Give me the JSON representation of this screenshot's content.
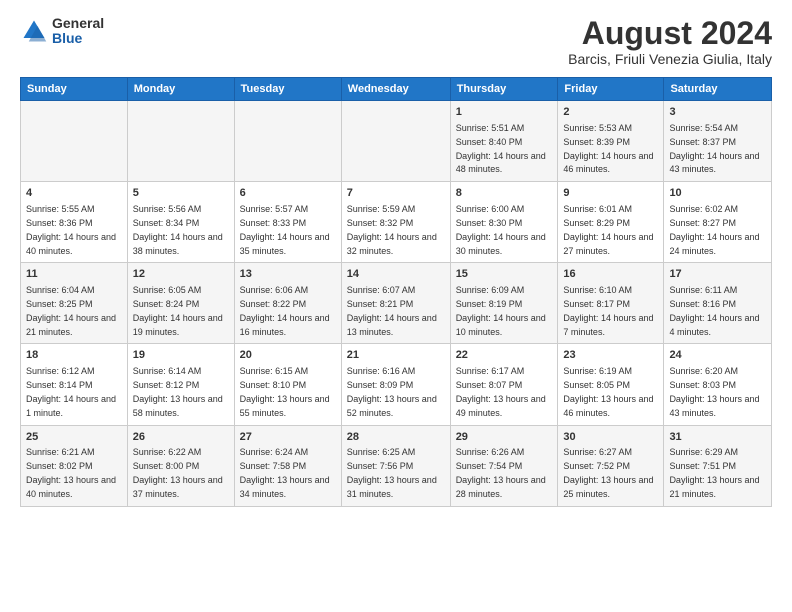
{
  "header": {
    "logo_general": "General",
    "logo_blue": "Blue",
    "title": "August 2024",
    "subtitle": "Barcis, Friuli Venezia Giulia, Italy"
  },
  "calendar": {
    "days_of_week": [
      "Sunday",
      "Monday",
      "Tuesday",
      "Wednesday",
      "Thursday",
      "Friday",
      "Saturday"
    ],
    "weeks": [
      [
        {
          "day": "",
          "info": ""
        },
        {
          "day": "",
          "info": ""
        },
        {
          "day": "",
          "info": ""
        },
        {
          "day": "",
          "info": ""
        },
        {
          "day": "1",
          "info": "Sunrise: 5:51 AM\nSunset: 8:40 PM\nDaylight: 14 hours and 48 minutes."
        },
        {
          "day": "2",
          "info": "Sunrise: 5:53 AM\nSunset: 8:39 PM\nDaylight: 14 hours and 46 minutes."
        },
        {
          "day": "3",
          "info": "Sunrise: 5:54 AM\nSunset: 8:37 PM\nDaylight: 14 hours and 43 minutes."
        }
      ],
      [
        {
          "day": "4",
          "info": "Sunrise: 5:55 AM\nSunset: 8:36 PM\nDaylight: 14 hours and 40 minutes."
        },
        {
          "day": "5",
          "info": "Sunrise: 5:56 AM\nSunset: 8:34 PM\nDaylight: 14 hours and 38 minutes."
        },
        {
          "day": "6",
          "info": "Sunrise: 5:57 AM\nSunset: 8:33 PM\nDaylight: 14 hours and 35 minutes."
        },
        {
          "day": "7",
          "info": "Sunrise: 5:59 AM\nSunset: 8:32 PM\nDaylight: 14 hours and 32 minutes."
        },
        {
          "day": "8",
          "info": "Sunrise: 6:00 AM\nSunset: 8:30 PM\nDaylight: 14 hours and 30 minutes."
        },
        {
          "day": "9",
          "info": "Sunrise: 6:01 AM\nSunset: 8:29 PM\nDaylight: 14 hours and 27 minutes."
        },
        {
          "day": "10",
          "info": "Sunrise: 6:02 AM\nSunset: 8:27 PM\nDaylight: 14 hours and 24 minutes."
        }
      ],
      [
        {
          "day": "11",
          "info": "Sunrise: 6:04 AM\nSunset: 8:25 PM\nDaylight: 14 hours and 21 minutes."
        },
        {
          "day": "12",
          "info": "Sunrise: 6:05 AM\nSunset: 8:24 PM\nDaylight: 14 hours and 19 minutes."
        },
        {
          "day": "13",
          "info": "Sunrise: 6:06 AM\nSunset: 8:22 PM\nDaylight: 14 hours and 16 minutes."
        },
        {
          "day": "14",
          "info": "Sunrise: 6:07 AM\nSunset: 8:21 PM\nDaylight: 14 hours and 13 minutes."
        },
        {
          "day": "15",
          "info": "Sunrise: 6:09 AM\nSunset: 8:19 PM\nDaylight: 14 hours and 10 minutes."
        },
        {
          "day": "16",
          "info": "Sunrise: 6:10 AM\nSunset: 8:17 PM\nDaylight: 14 hours and 7 minutes."
        },
        {
          "day": "17",
          "info": "Sunrise: 6:11 AM\nSunset: 8:16 PM\nDaylight: 14 hours and 4 minutes."
        }
      ],
      [
        {
          "day": "18",
          "info": "Sunrise: 6:12 AM\nSunset: 8:14 PM\nDaylight: 14 hours and 1 minute."
        },
        {
          "day": "19",
          "info": "Sunrise: 6:14 AM\nSunset: 8:12 PM\nDaylight: 13 hours and 58 minutes."
        },
        {
          "day": "20",
          "info": "Sunrise: 6:15 AM\nSunset: 8:10 PM\nDaylight: 13 hours and 55 minutes."
        },
        {
          "day": "21",
          "info": "Sunrise: 6:16 AM\nSunset: 8:09 PM\nDaylight: 13 hours and 52 minutes."
        },
        {
          "day": "22",
          "info": "Sunrise: 6:17 AM\nSunset: 8:07 PM\nDaylight: 13 hours and 49 minutes."
        },
        {
          "day": "23",
          "info": "Sunrise: 6:19 AM\nSunset: 8:05 PM\nDaylight: 13 hours and 46 minutes."
        },
        {
          "day": "24",
          "info": "Sunrise: 6:20 AM\nSunset: 8:03 PM\nDaylight: 13 hours and 43 minutes."
        }
      ],
      [
        {
          "day": "25",
          "info": "Sunrise: 6:21 AM\nSunset: 8:02 PM\nDaylight: 13 hours and 40 minutes."
        },
        {
          "day": "26",
          "info": "Sunrise: 6:22 AM\nSunset: 8:00 PM\nDaylight: 13 hours and 37 minutes."
        },
        {
          "day": "27",
          "info": "Sunrise: 6:24 AM\nSunset: 7:58 PM\nDaylight: 13 hours and 34 minutes."
        },
        {
          "day": "28",
          "info": "Sunrise: 6:25 AM\nSunset: 7:56 PM\nDaylight: 13 hours and 31 minutes."
        },
        {
          "day": "29",
          "info": "Sunrise: 6:26 AM\nSunset: 7:54 PM\nDaylight: 13 hours and 28 minutes."
        },
        {
          "day": "30",
          "info": "Sunrise: 6:27 AM\nSunset: 7:52 PM\nDaylight: 13 hours and 25 minutes."
        },
        {
          "day": "31",
          "info": "Sunrise: 6:29 AM\nSunset: 7:51 PM\nDaylight: 13 hours and 21 minutes."
        }
      ]
    ]
  }
}
